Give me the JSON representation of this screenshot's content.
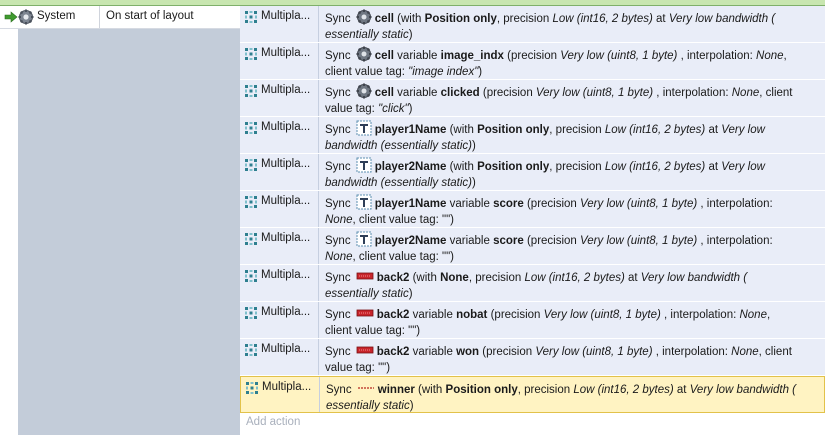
{
  "event": {
    "condition": {
      "object": "System",
      "text": "On start of layout"
    }
  },
  "actions": [
    {
      "object": "Multipla...",
      "verb": "Sync",
      "icon": "cell-icon",
      "target": "cell",
      "rest1": "(with ",
      "b1": "Position only",
      "rest2": ", precision ",
      "i1": "Low (int16, 2 bytes)",
      "rest3": "   at ",
      "i2": "Very low bandwidth (",
      "line2": "essentially static",
      "line2end": ")"
    },
    {
      "object": "Multipla...",
      "verb": "Sync",
      "icon": "cell-icon",
      "target": "cell",
      "v_word": "variable",
      "var": "image_indx",
      "p1": "(precision ",
      "i1": "Very low (uint8, 1 byte)",
      "p2": " , interpolation: ",
      "i2": "None",
      "p3": ",",
      "line2a": "client value tag: ",
      "line2i": "\"image index\"",
      "line2end": ")"
    },
    {
      "object": "Multipla...",
      "verb": "Sync",
      "icon": "cell-icon",
      "target": "cell",
      "v_word": "variable",
      "var": "clicked",
      "p1": "(precision ",
      "i1": "Very low (uint8, 1 byte)",
      "p2": " , interpolation: ",
      "i2": "None",
      "p3": ", client",
      "line2a": "value tag: ",
      "line2i": "\"click\"",
      "line2end": ")"
    },
    {
      "object": "Multipla...",
      "verb": "Sync",
      "icon": "text-icon",
      "target": "player1Name",
      "rest1": "(with ",
      "b1": "Position only",
      "rest2": ", precision ",
      "i1": "Low (int16, 2 bytes)",
      "rest3": "   at ",
      "i2": "Very low",
      "line2": "bandwidth (essentially static)",
      "line2end": ")"
    },
    {
      "object": "Multipla...",
      "verb": "Sync",
      "icon": "text-icon",
      "target": "player2Name",
      "rest1": "(with ",
      "b1": "Position only",
      "rest2": ", precision ",
      "i1": "Low (int16, 2 bytes)",
      "rest3": "   at ",
      "i2": "Very low",
      "line2": "bandwidth (essentially static)",
      "line2end": ")"
    },
    {
      "object": "Multipla...",
      "verb": "Sync",
      "icon": "text-icon",
      "target": "player1Name",
      "v_word": "variable",
      "var": "score",
      "p1": "(precision ",
      "i1": "Very low (uint8, 1 byte)",
      "p2": " , interpolation:",
      "i2": "",
      "p3": "",
      "line2a": "",
      "line2i": "None",
      "line2b": ", client value tag: \"\")",
      "line2end": ""
    },
    {
      "object": "Multipla...",
      "verb": "Sync",
      "icon": "text-icon",
      "target": "player2Name",
      "v_word": "variable",
      "var": "score",
      "p1": "(precision ",
      "i1": "Very low (uint8, 1 byte)",
      "p2": " , interpolation:",
      "i2": "",
      "p3": "",
      "line2a": "",
      "line2i": "None",
      "line2b": ", client value tag: \"\")",
      "line2end": ""
    },
    {
      "object": "Multipla...",
      "verb": "Sync",
      "icon": "sprite-icon",
      "target": "back2",
      "rest1": "(with ",
      "b1": "None",
      "rest2": ", precision ",
      "i1": "Low (int16, 2 bytes)",
      "rest3": "   at ",
      "i2": "Very low bandwidth (",
      "line2": "essentially static",
      "line2end": ")"
    },
    {
      "object": "Multipla...",
      "verb": "Sync",
      "icon": "sprite-icon",
      "target": "back2",
      "v_word": "variable",
      "var": "nobat",
      "p1": "(precision ",
      "i1": "Very low (uint8, 1 byte)",
      "p2": " , interpolation: ",
      "i2": "None",
      "p3": ",",
      "line2a": "client value tag: \"\")",
      "line2i": "",
      "line2end": ""
    },
    {
      "object": "Multipla...",
      "verb": "Sync",
      "icon": "sprite-icon",
      "target": "back2",
      "v_word": "variable",
      "var": "won",
      "p1": "(precision ",
      "i1": "Very low (uint8, 1 byte)",
      "p2": " , interpolation: ",
      "i2": "None",
      "p3": ", client",
      "line2a": "value tag: \"\")",
      "line2i": "",
      "line2end": ""
    },
    {
      "object": "Multipla...",
      "verb": "Sync",
      "icon": "line-icon",
      "target": "winner",
      "rest1": "(with ",
      "b1": "Position only",
      "rest2": ", precision ",
      "i1": "Low (int16, 2 bytes)",
      "rest3": "   at ",
      "i2": "Very low bandwidth (",
      "line2": "essentially static",
      "line2end": ")"
    }
  ],
  "add_action": "Add action",
  "colors": {
    "action_bg": "#e9edf8",
    "selected_bg": "#fff3c2",
    "left_bg": "#c3ccd9",
    "header_green": "#c8e6b0"
  }
}
